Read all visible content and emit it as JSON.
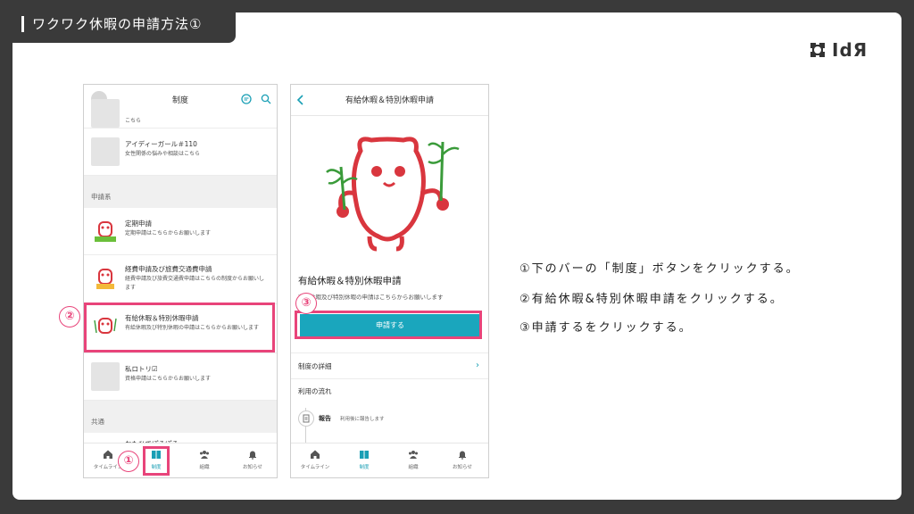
{
  "slide": {
    "title": "ワクワク休暇の申請方法①",
    "logo_text": "IdЯ"
  },
  "phone1": {
    "header_title": "制度",
    "top_row_sub": "こちら",
    "rows": [
      {
        "title": "アイディーガール＃110",
        "sub": "女性関係の悩みや相談はこちら"
      },
      {
        "title": "定期申請",
        "sub": "定期申請はこちらからお願いします"
      },
      {
        "title": "経費申請及び旅費交通費申請",
        "sub": "経費申請及び旅費交通費申請はこちらの制度からお願いします"
      },
      {
        "title": "有給休暇＆特別休暇申請",
        "sub": "有給休暇及び特別休暇の申請はこちらからお願いします"
      },
      {
        "title": "私ロトリ☑",
        "sub": "資格申請はこちらからお願いします"
      },
      {
        "title": "おもひでぽろぽろ",
        "sub": ""
      }
    ],
    "sections": [
      "申請系",
      "共通"
    ],
    "tabs": [
      "タイムライン",
      "制度",
      "組織",
      "お知らせ"
    ]
  },
  "phone2": {
    "header_title": "有給休暇＆特別休暇申請",
    "heading": "有給休暇＆特別休暇申請",
    "desc": "有給休暇及び特別休暇の申請はこちらからお願いします",
    "apply_label": "申請する",
    "detail_label": "制度の詳細",
    "flow_label": "利用の流れ",
    "flow_step_title": "報告",
    "flow_step_sub": "利用後に報告します",
    "tabs": [
      "タイムライン",
      "制度",
      "組織",
      "お知らせ"
    ]
  },
  "markers": [
    "①",
    "②",
    "③"
  ],
  "instructions": [
    "①下のバーの「制度」ボタンをクリックする。",
    "②有給休暇&特別休暇申請をクリックする。",
    "③申請するをクリックする。"
  ],
  "colors": {
    "accent": "#1aa6bd",
    "highlight": "#e8447a",
    "frame": "#3a3a3a"
  }
}
